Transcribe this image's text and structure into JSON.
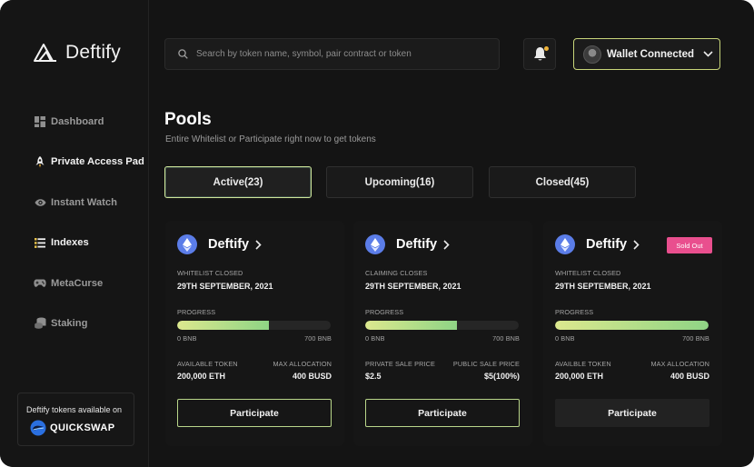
{
  "app": {
    "name": "Deftify"
  },
  "sidebar": {
    "items": [
      {
        "label": "Dashboard",
        "icon": "dashboard-icon",
        "active": false
      },
      {
        "label": "Private Access Pad",
        "icon": "rocket-icon",
        "active": true
      },
      {
        "label": "Instant Watch",
        "icon": "eye-icon",
        "active": false
      },
      {
        "label": "Indexes",
        "icon": "list-icon",
        "active": true
      },
      {
        "label": "MetaCurse",
        "icon": "gamepad-icon",
        "active": false
      },
      {
        "label": "Staking",
        "icon": "coins-icon",
        "active": false
      }
    ],
    "promo": {
      "text": "Deftify tokens available on",
      "brand": "QUICKSWAP"
    }
  },
  "header": {
    "search_placeholder": "Search by token name, symbol, pair contract or token",
    "wallet_label": "Wallet Connected"
  },
  "page": {
    "title": "Pools",
    "subtitle": "Entire Whitelist or Participate right now to get tokens"
  },
  "tabs": [
    {
      "label": "Active(23)",
      "active": true
    },
    {
      "label": "Upcoming(16)",
      "active": false
    },
    {
      "label": "Closed(45)",
      "active": false
    }
  ],
  "colors": {
    "accent": "#cfe69a",
    "progress_start": "#dce88e",
    "progress_end": "#8fd485",
    "sold_out": "#e94f8e",
    "eth": "#5b7de8"
  },
  "cards": [
    {
      "name": "Deftify",
      "badge": "",
      "date_label": "WHITELIST CLOSED",
      "date": "29TH SEPTEMBER, 2021",
      "progress_label": "PROGRESS",
      "progress": 0.6,
      "min": "0 BNB",
      "max": "700 BNB",
      "left_label": "AVAILABLE TOKEN",
      "left_value": "200,000 ETH",
      "right_label": "MAX ALLOCATION",
      "right_value": "400 BUSD",
      "button": "Participate",
      "button_enabled": true
    },
    {
      "name": "Deftify",
      "badge": "",
      "date_label": "CLAIMING CLOSES",
      "date": "29TH SEPTEMBER, 2021",
      "progress_label": "PROGRESS",
      "progress": 0.6,
      "min": "0 BNB",
      "max": "700 BNB",
      "left_label": "PRIVATE SALE PRICE",
      "left_value": "$2.5",
      "right_label": "PUBLIC SALE PRICE",
      "right_value": "$5(100%)",
      "button": "Participate",
      "button_enabled": true
    },
    {
      "name": "Deftify",
      "badge": "Sold Out",
      "date_label": "WHITELIST CLOSED",
      "date": "29TH SEPTEMBER, 2021",
      "progress_label": "PROGRESS",
      "progress": 1.0,
      "min": "0 BNB",
      "max": "700 BNB",
      "left_label": "AVAILBLE TOKEN",
      "left_value": "200,000 ETH",
      "right_label": "MAX ALLOCATION",
      "right_value": "400 BUSD",
      "button": "Participate",
      "button_enabled": false
    }
  ]
}
